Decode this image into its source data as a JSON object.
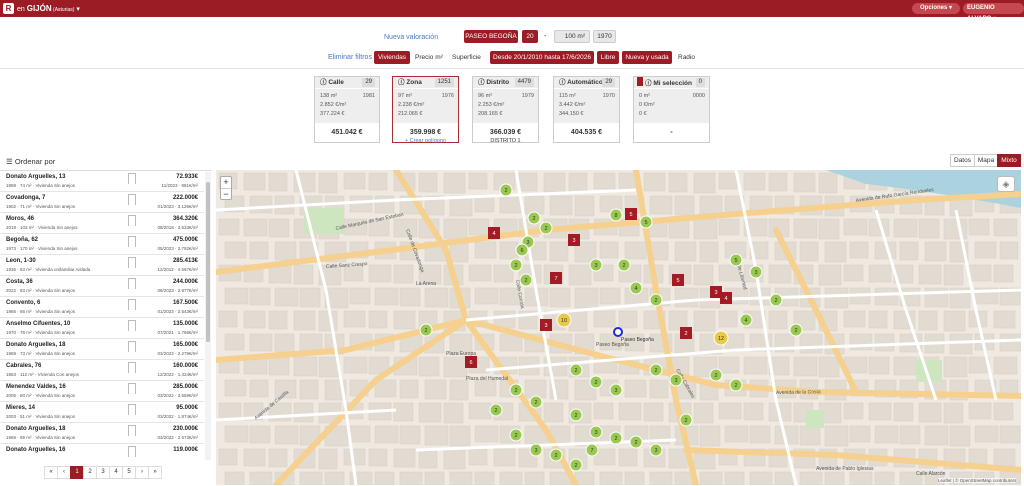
{
  "topbar": {
    "logo": "R",
    "city_prefix": "en ",
    "city": "GIJÓN",
    "region": " (Asturias)",
    "caret": " ▾",
    "options": "Opciones ▾",
    "user": "EUGENIO ALVARO ▾"
  },
  "valuation": {
    "label": "Nueva valoración",
    "street": "PASEO BEGOÑA",
    "number": "20",
    "dash": "-",
    "area": "100 m²",
    "year": "1970"
  },
  "filters": {
    "clear": "Eliminar filtros",
    "viviendas": "Viviendas",
    "precio": "Precio m²",
    "superficie": "Superficie",
    "dates": "Desde 20/1/2010 hasta 17/6/2026",
    "libre": "Libre",
    "nueva": "Nueva y usada",
    "radio": "Radio"
  },
  "cards": [
    {
      "title": "Calle",
      "count": "29",
      "l1": "138 m²",
      "year": "1981",
      "l2": "2.852 €/m²",
      "l3": "377.224 €",
      "total": "451.042 €",
      "sub": "",
      "link": false
    },
    {
      "title": "Zona",
      "count": "1251",
      "l1": "97 m²",
      "year": "1976",
      "l2": "2.238 €/m²",
      "l3": "212.065 €",
      "total": "359.998 €",
      "sub": "+ Crear polígono",
      "link": true
    },
    {
      "title": "Distrito",
      "count": "4479",
      "l1": "96 m²",
      "year": "1979",
      "l2": "2.253 €/m²",
      "l3": "208.165 €",
      "total": "366.039 €",
      "sub": "DISTRITO 1",
      "link": false
    },
    {
      "title": "Automático",
      "count": "29",
      "l1": "115 m²",
      "year": "1970",
      "l2": "3.442 €/m²",
      "l3": "344.150 €",
      "total": "404.535 €",
      "sub": "",
      "link": false
    },
    {
      "title": "Mi selección",
      "count": "0",
      "l1": "0 m²",
      "year": "0000",
      "l2": "0 €/m²",
      "l3": "0 €",
      "total": "-",
      "sub": "",
      "link": false
    }
  ],
  "list_header": {
    "sort": "Ordenar por"
  },
  "views": {
    "datos": "Datos",
    "mapa": "Mapa",
    "mixto": "Mixto"
  },
  "items": [
    {
      "name": "Donato Arguelles, 13",
      "desc": "1959 · 74 m² · Vivienda Sin anejos",
      "price": "72.933€",
      "date": "11/2023 · 981€/m²"
    },
    {
      "name": "Covadonga, 7",
      "desc": "1902 · 71 m² · Vivienda Sin anejos",
      "price": "222.000€",
      "date": "01/2023 · 3.126€/m²"
    },
    {
      "name": "Moros, 46",
      "desc": "2018 · 103 m² · Vivienda Sin anejos",
      "price": "364.320€",
      "date": "08/2018 · 3.533€/m²"
    },
    {
      "name": "Begoña, 62",
      "desc": "1973 · 170 m² · Vivienda Sin anejos",
      "price": "475.000€",
      "date": "05/2023 · 2.792€/m²"
    },
    {
      "name": "Leon, 1-30",
      "desc": "1936 · 63 m² · Vivienda unifamiliar Aislada",
      "price": "285.413€",
      "date": "12/2012 · 4.567€/m²"
    },
    {
      "name": "Costa, 36",
      "desc": "2022 · 83 m² · Vivienda Sin anejos",
      "price": "244.000€",
      "date": "09/2023 · 2.977€/m²"
    },
    {
      "name": "Convento, 6",
      "desc": "1966 · 66 m² · Vivienda Sin anejos",
      "price": "167.500€",
      "date": "01/2023 · 2.543€/m²"
    },
    {
      "name": "Anselmo Cifuentes, 10",
      "desc": "1970 · 76 m² · Vivienda Sin anejos",
      "price": "135.000€",
      "date": "07/2021 · 1.786€/m²"
    },
    {
      "name": "Donato Arguelles, 18",
      "desc": "1969 · 73 m² · Vivienda Sin anejos",
      "price": "165.000€",
      "date": "03/2022 · 2.279€/m²"
    },
    {
      "name": "Cabrales, 76",
      "desc": "1863 · 112 m² · Vivienda Con anejos",
      "price": "160.000€",
      "date": "12/2022 · 1.424€/m²"
    },
    {
      "name": "Menendez Valdes, 16",
      "desc": "2005 · 80 m² · Vivienda Sin anejos",
      "price": "285.000€",
      "date": "03/2022 · 3.559€/m²"
    },
    {
      "name": "Mieres, 14",
      "desc": "2003 · 51 m² · Vivienda Sin anejos",
      "price": "95.000€",
      "date": "03/2022 · 1.874€/m²"
    },
    {
      "name": "Donato Arguelles, 18",
      "desc": "1969 · 89 m² · Vivienda Sin anejos",
      "price": "230.000€",
      "date": "03/2022 · 2.573€/m²"
    },
    {
      "name": "Donato Arguelles, 16",
      "desc": "",
      "price": "119.000€",
      "date": ""
    }
  ],
  "pager": [
    "«",
    "‹",
    "1",
    "2",
    "3",
    "4",
    "5",
    "›",
    "»"
  ],
  "map": {
    "zoom_in": "+",
    "zoom_out": "−",
    "attribution": "Leaflet | © OpenStreetMap contributors",
    "streets": [
      "Avenida de la Costa",
      "Calle Marqués de San Esteban",
      "Avenida de Rufo García Rendueles",
      "Calle Sanz Crespo",
      "Paseo Begoña",
      "Plaza Europa",
      "Calle Corrida",
      "Calle Libertad",
      "Avenida de Pablo Iglesias",
      "Avenida de Castilla",
      "Calle Cabrales",
      "Plaza del Humedal",
      "La Arena",
      "Calle Alarcón",
      "Calle de Covadonga"
    ],
    "colors": {
      "green": "#9ac952",
      "red": "#a31b24",
      "yellow": "#e9c84a",
      "road_yellow": "#f5d08e",
      "block": "#e2dbd1",
      "park": "#cde6c0",
      "sea": "#aad3df"
    },
    "clusters": [
      {
        "n": "2",
        "k": "g"
      },
      {
        "n": "2",
        "k": "g"
      },
      {
        "n": "2",
        "k": "g"
      },
      {
        "n": "3",
        "k": "g"
      },
      {
        "n": "6",
        "k": "g"
      },
      {
        "n": "4",
        "k": "r"
      },
      {
        "n": "3",
        "k": "r"
      },
      {
        "n": "7",
        "k": "r"
      },
      {
        "n": "5",
        "k": "r"
      },
      {
        "n": "3",
        "k": "r"
      },
      {
        "n": "4",
        "k": "r"
      },
      {
        "n": "3",
        "k": "r"
      },
      {
        "n": "2",
        "k": "r"
      },
      {
        "n": "6",
        "k": "r"
      },
      {
        "n": "5",
        "k": "r"
      },
      {
        "n": "10",
        "k": "y"
      },
      {
        "n": "12",
        "k": "y"
      },
      {
        "n": "8",
        "k": "g"
      },
      {
        "n": "5",
        "k": "g"
      },
      {
        "n": "2",
        "k": "g"
      },
      {
        "n": "4",
        "k": "g"
      },
      {
        "n": "2",
        "k": "g"
      },
      {
        "n": "2",
        "k": "g"
      },
      {
        "n": "2",
        "k": "g"
      },
      {
        "n": "3",
        "k": "g"
      },
      {
        "n": "5",
        "k": "g"
      },
      {
        "n": "3",
        "k": "g"
      },
      {
        "n": "2",
        "k": "g"
      },
      {
        "n": "2",
        "k": "g"
      },
      {
        "n": "3",
        "k": "g"
      },
      {
        "n": "2",
        "k": "g"
      },
      {
        "n": "2",
        "k": "g"
      },
      {
        "n": "2",
        "k": "g"
      },
      {
        "n": "2",
        "k": "g"
      },
      {
        "n": "3",
        "k": "g"
      },
      {
        "n": "2",
        "k": "g"
      },
      {
        "n": "2",
        "k": "g"
      },
      {
        "n": "4",
        "k": "g"
      },
      {
        "n": "2",
        "k": "g"
      },
      {
        "n": "3",
        "k": "g"
      },
      {
        "n": "2",
        "k": "g"
      },
      {
        "n": "7",
        "k": "g"
      },
      {
        "n": "2",
        "k": "g"
      },
      {
        "n": "3",
        "k": "g"
      },
      {
        "n": "2",
        "k": "g"
      },
      {
        "n": "2",
        "k": "g"
      },
      {
        "n": "3",
        "k": "g"
      },
      {
        "n": "2",
        "k": "g"
      },
      {
        "n": "2",
        "k": "g"
      },
      {
        "n": "2",
        "k": "g"
      },
      {
        "n": "2",
        "k": "g"
      },
      {
        "n": "2",
        "k": "g"
      }
    ],
    "position_label": "Paseo Begoña"
  }
}
